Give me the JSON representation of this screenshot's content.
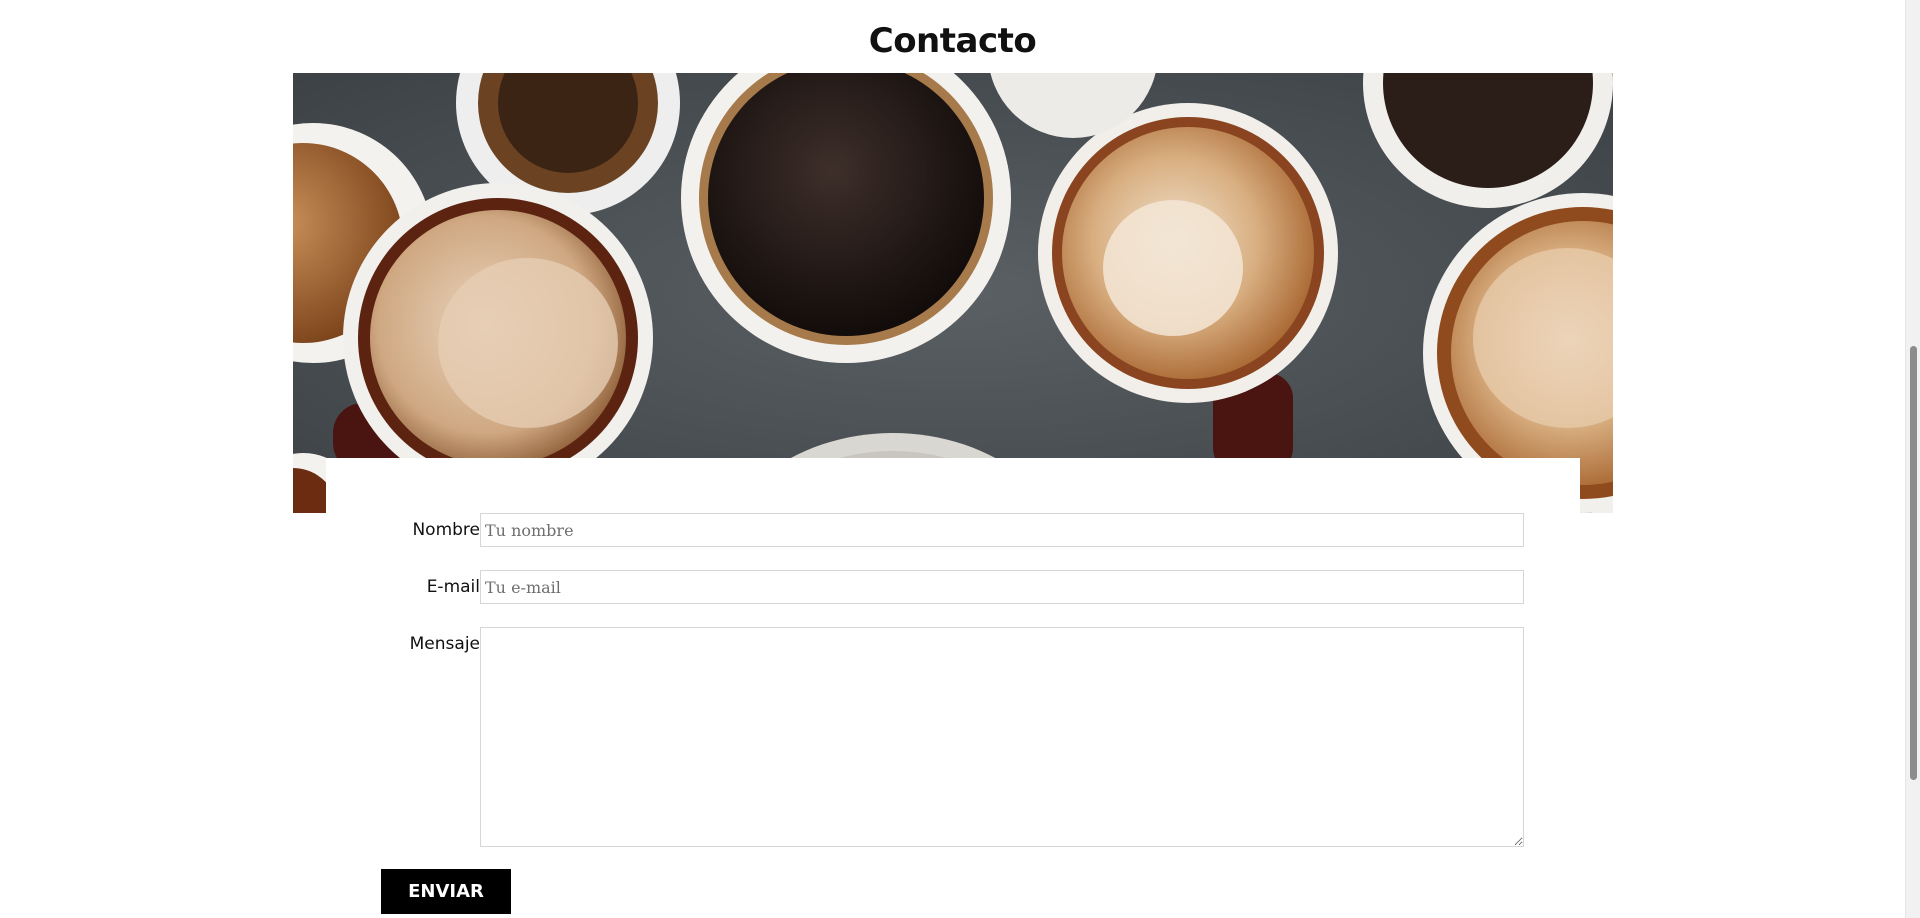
{
  "page": {
    "title": "Contacto"
  },
  "hero": {
    "description_icon": "coffee-cups-photo"
  },
  "form": {
    "name_label": "Nombre",
    "name_placeholder": "Tu nombre",
    "name_value": "",
    "email_label": "E-mail",
    "email_placeholder": "Tu e-mail",
    "email_value": "",
    "message_label": "Mensaje",
    "message_value": "",
    "submit_label": "ENVIAR"
  },
  "colors": {
    "button_bg": "#000000",
    "button_text": "#ffffff",
    "field_border": "#d6d6d6"
  }
}
